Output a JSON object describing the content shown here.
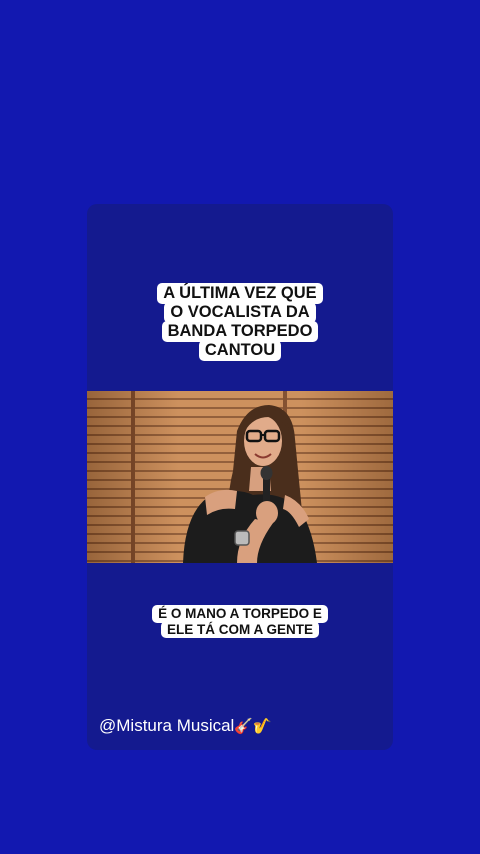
{
  "caption_top": [
    "A ÚLTIMA VEZ QUE",
    "O VOCALISTA DA",
    "BANDA TORPEDO",
    "CANTOU"
  ],
  "caption_bottom": [
    "É O MANO A TORPEDO E",
    "ELE TÁ COM A GENTE"
  ],
  "handle": "@Mistura Musical",
  "handle_emoji": "🎸🎷",
  "colors": {
    "background": "#1218b0",
    "card": "#141a8f",
    "caption_bg": "#ffffff",
    "caption_text": "#111111"
  }
}
